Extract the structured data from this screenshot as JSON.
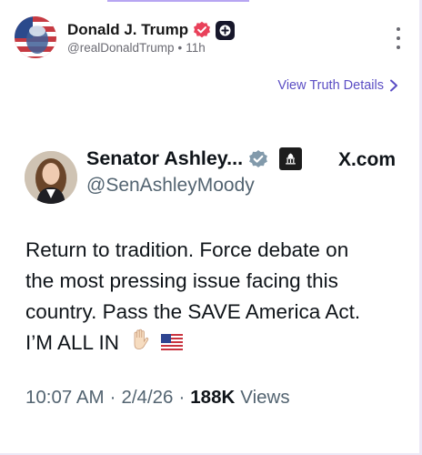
{
  "post": {
    "author_name": "Donald J. Trump",
    "handle": "@realDonaldTrump",
    "separator": "•",
    "time_ago": "11h",
    "view_details_label": "View Truth Details"
  },
  "embed": {
    "author_name": "Senator Ashley...",
    "handle": "@SenAshleyMoody",
    "source": "X.com",
    "body_lines": [
      "Return to tradition. Force debate on",
      "the most pressing issue facing this",
      "country. Pass the SAVE America Act.",
      "I’M ALL IN"
    ],
    "time": "10:07 AM",
    "dot": "·",
    "date": "2/4/26",
    "views_count": "188K",
    "views_label": "Views"
  },
  "colors": {
    "link_purple": "#5b4ec4",
    "verified_red": "#e9415a",
    "verified_grey": "#829aab",
    "muted_text": "#536471"
  },
  "icons": [
    "verified-badge-icon",
    "plus-badge-icon",
    "more-options-icon",
    "chevron-right-icon",
    "capitol-badge-icon",
    "hand-emoji",
    "us-flag-emoji"
  ]
}
